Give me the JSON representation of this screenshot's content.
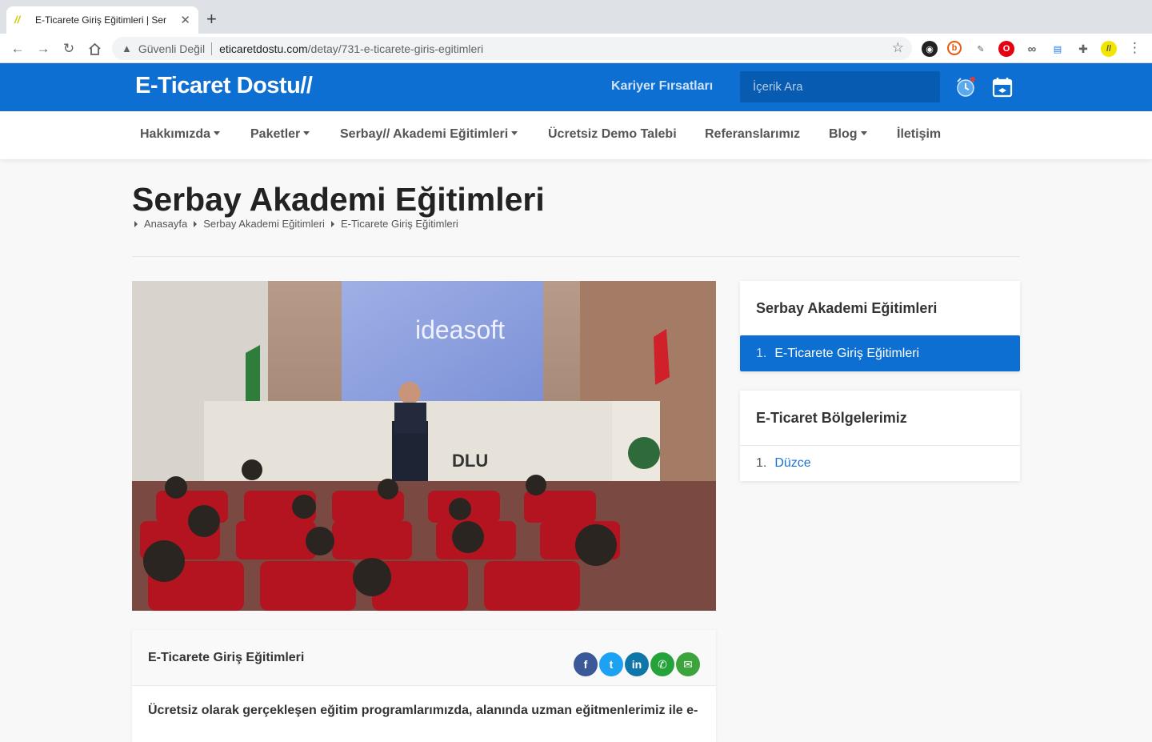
{
  "browser": {
    "tab_title": "E-Ticarete Giriş Eğitimleri | Ser",
    "tab_favicon": "//",
    "not_secure_label": "Güvenli Değil",
    "url_host": "eticaretdostu.com",
    "url_path": "/detay/731-e-ticarete-giris-egitimleri",
    "extensions": [
      "vpn-icon",
      "b-extension-icon",
      "eyedropper-icon",
      "opera-icon",
      "infinity-icon",
      "counter-icon",
      "puzzle-icon",
      "profile-icon"
    ]
  },
  "header": {
    "logo": "E-Ticaret Dostu//",
    "career_link": "Kariyer Fırsatları",
    "search_placeholder": "İçerik Ara",
    "accent_color": "#0d6fd1"
  },
  "nav": {
    "items": [
      {
        "label": "Hakkımızda",
        "dropdown": true
      },
      {
        "label": "Paketler",
        "dropdown": true
      },
      {
        "label": "Serbay// Akademi Eğitimleri",
        "dropdown": true
      },
      {
        "label": "Ücretsiz Demo Talebi",
        "dropdown": false
      },
      {
        "label": "Referanslarımız",
        "dropdown": false
      },
      {
        "label": "Blog",
        "dropdown": true
      },
      {
        "label": "İletişim",
        "dropdown": false
      }
    ]
  },
  "page": {
    "title": "Serbay Akademi Eğitimleri",
    "breadcrumb": [
      "Anasayfa",
      "Serbay Akademi Eğitimleri",
      "E-Ticarete Giriş Eğitimleri"
    ],
    "hero_screen_text": "ideasoft",
    "hero_podium_text": "DLU"
  },
  "content": {
    "title": "E-Ticarete Giriş Eğitimleri",
    "share": [
      "facebook-icon",
      "twitter-icon",
      "linkedin-icon",
      "whatsapp-icon",
      "email-icon"
    ],
    "intro": "Ücretsiz olarak gerçekleşen eğitim programlarımızda, alanında uzman eğitmenlerimiz ile e-"
  },
  "sidebar": {
    "academy": {
      "title": "Serbay Akademi Eğitimleri",
      "items": [
        {
          "num": "1.",
          "label": "E-Ticarete Giriş Eğitimleri"
        }
      ]
    },
    "regions": {
      "title": "E-Ticaret Bölgelerimiz",
      "items": [
        {
          "num": "1.",
          "label": "Düzce"
        }
      ]
    }
  }
}
